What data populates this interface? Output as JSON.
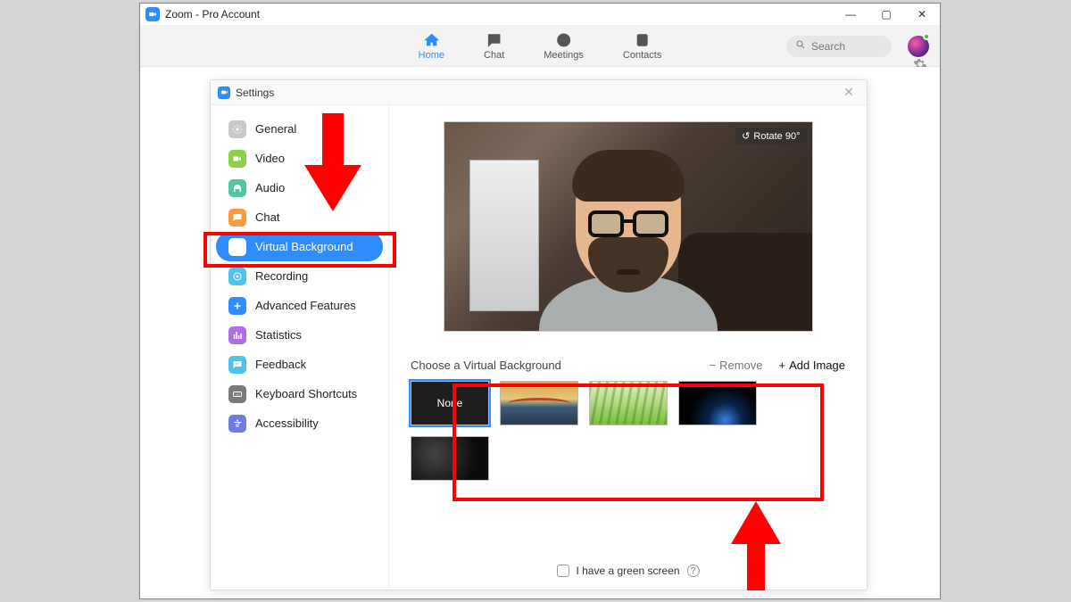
{
  "window": {
    "title": "Zoom - Pro Account"
  },
  "nav": {
    "home": "Home",
    "chat": "Chat",
    "meetings": "Meetings",
    "contacts": "Contacts",
    "active": "home"
  },
  "search": {
    "placeholder": "Search"
  },
  "settings": {
    "title": "Settings",
    "active": "virtual_background",
    "items": {
      "general": "General",
      "video": "Video",
      "audio": "Audio",
      "chat": "Chat",
      "virtual_background": "Virtual Background",
      "recording": "Recording",
      "advanced_features": "Advanced Features",
      "statistics": "Statistics",
      "feedback": "Feedback",
      "keyboard_shortcuts": "Keyboard Shortcuts",
      "accessibility": "Accessibility"
    },
    "icon_colors": {
      "general": "#c9c9c9",
      "video": "#8bd24a",
      "audio": "#50c9a2",
      "chat": "#ff9a3c",
      "virtual_background": "#2D8CFF",
      "recording": "#4fc3e8",
      "advanced_features": "#2D8CFF",
      "statistics": "#b06ee6",
      "feedback": "#4fc3e8",
      "keyboard_shortcuts": "#7a7a7a",
      "accessibility": "#6f7bdf"
    }
  },
  "virtual_bg": {
    "rotate_label": "Rotate 90°",
    "choose_label": "Choose a Virtual Background",
    "remove_label": "Remove",
    "add_label": "Add Image",
    "none_label": "None",
    "green_screen_label": "I have a green screen",
    "selected_index": 0,
    "thumbnails": [
      "none",
      "bridge",
      "grass",
      "space",
      "dark"
    ]
  },
  "annotations": {
    "sidebar_highlight": true,
    "thumbs_highlight": true,
    "arrow_down": true,
    "arrow_up": true
  }
}
